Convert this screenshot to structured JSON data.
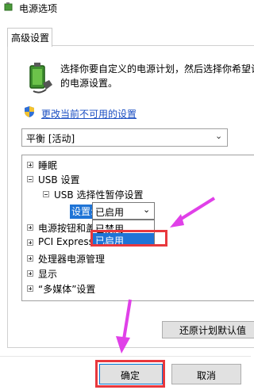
{
  "window": {
    "title": "电源选项"
  },
  "tabs": [
    {
      "label": "高级设置"
    }
  ],
  "description": {
    "line1": "选择你要自定义的电源计划，然后选择你希望计",
    "line2": "的电源设置。"
  },
  "change_link": "更改当前不可用的设置",
  "plan_select": {
    "value": "平衡 [活动]"
  },
  "tree": {
    "items": [
      {
        "label": "睡眠",
        "state": "collapsed"
      },
      {
        "label": "USB 设置",
        "state": "expanded"
      },
      {
        "label": "USB 选择性暂停设置",
        "state": "expanded"
      },
      {
        "label": "电源按钮和盖",
        "state": "collapsed"
      },
      {
        "label": "PCI Express",
        "state": "collapsed"
      },
      {
        "label": "处理器电源管理",
        "state": "collapsed"
      },
      {
        "label": "显示",
        "state": "collapsed"
      },
      {
        "label": "“多媒体”设置",
        "state": "collapsed"
      }
    ],
    "setting_label": "设置:",
    "setting_value": "已启用",
    "dropdown_options": [
      "已禁用",
      "已启用"
    ],
    "selected_option": "已启用"
  },
  "buttons": {
    "restore": "还原计划默认值",
    "ok": "确定",
    "cancel": "取消"
  },
  "colors": {
    "highlight": "#1f74d6",
    "annotation_red": "#e8383d",
    "annotation_arrow": "#e040e8",
    "link": "#1a4ec2"
  },
  "icons": {
    "title": "power-options-icon",
    "battery": "battery-plug-icon",
    "shield": "uac-shield-icon"
  }
}
